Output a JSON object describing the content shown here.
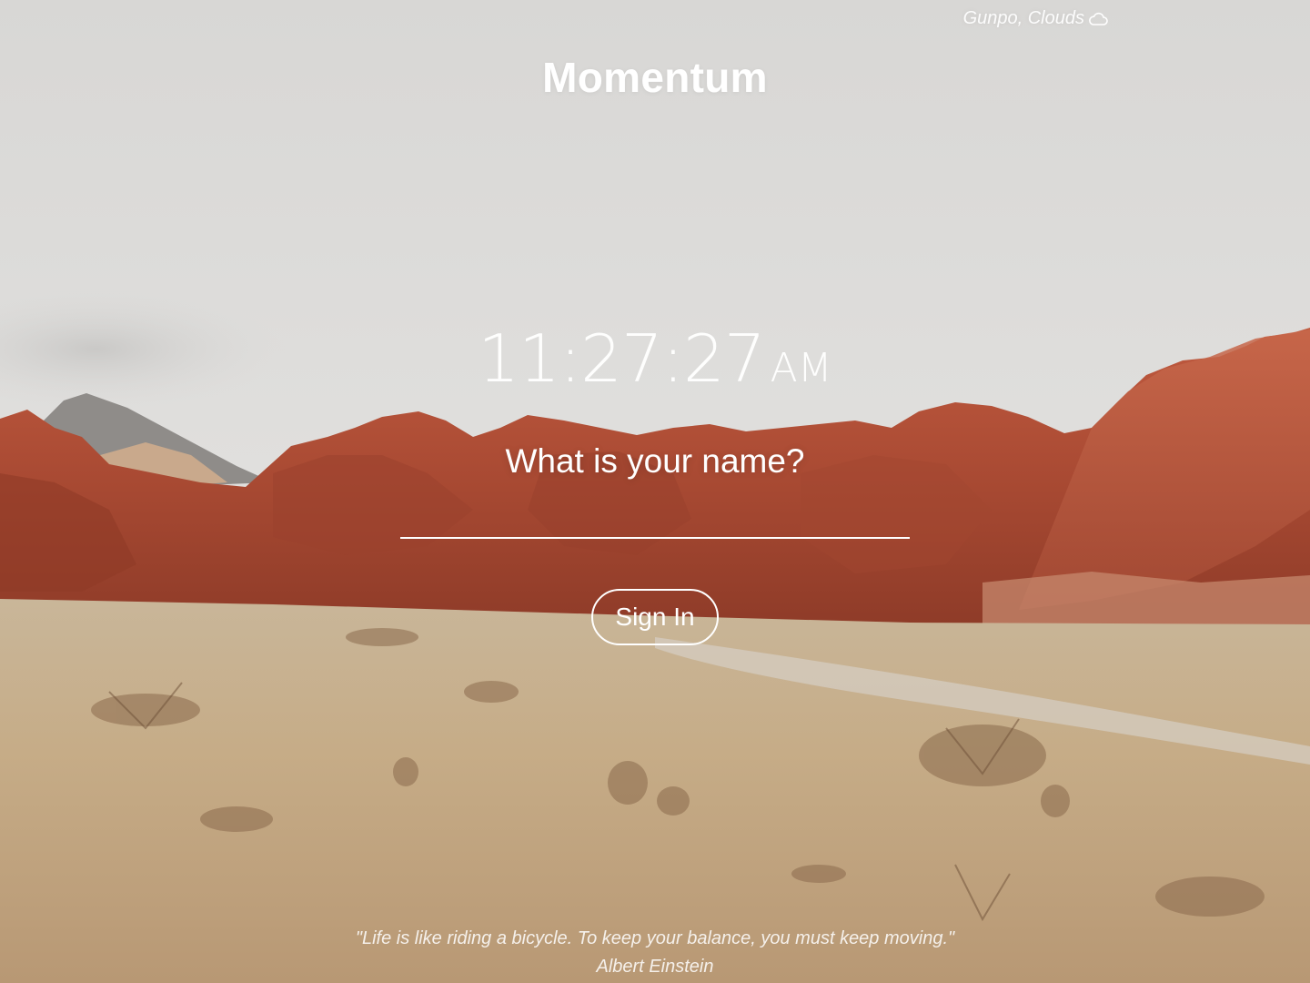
{
  "weather": {
    "location": "Gunpo, Clouds",
    "icon": "cloud-icon"
  },
  "brand": {
    "title": "Momentum"
  },
  "clock": {
    "time": "11:27:27",
    "period": "AM"
  },
  "greeting": {
    "question": "What is your name?",
    "input_value": "",
    "placeholder": ""
  },
  "actions": {
    "sign_in_label": "Sign In"
  },
  "quote": {
    "text": "\"Life is like riding a bicycle. To keep your balance, you must keep moving.\"",
    "author": "Albert Einstein"
  },
  "colors": {
    "text": "#ffffff",
    "sky": "#dcdbd9",
    "rock": "#b4523a",
    "ground": "#c7b08e"
  }
}
